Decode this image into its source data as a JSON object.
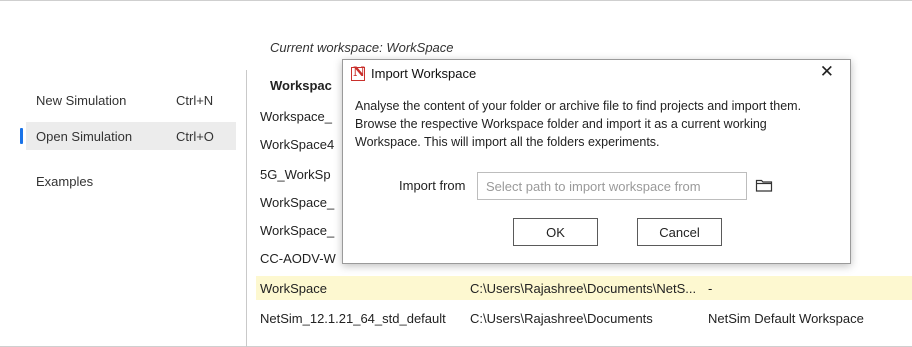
{
  "menu": {
    "items": [
      {
        "label": "New Simulation",
        "shortcut": "Ctrl+N"
      },
      {
        "label": "Open Simulation",
        "shortcut": "Ctrl+O"
      },
      {
        "label": "Examples",
        "shortcut": ""
      }
    ]
  },
  "workspace": {
    "current": "Current workspace:  WorkSpace",
    "header": "Workspac",
    "rows": [
      {
        "name": "Workspace_",
        "path": "",
        "desc": ""
      },
      {
        "name": "WorkSpace4",
        "path": "",
        "desc": ""
      },
      {
        "name": "5G_WorkSp",
        "path": "",
        "desc": ""
      },
      {
        "name": "WorkSpace_",
        "path": "",
        "desc": ""
      },
      {
        "name": "WorkSpace_",
        "path": "",
        "desc": ""
      },
      {
        "name": "CC-AODV-W",
        "path": "",
        "desc": ""
      },
      {
        "name": "WorkSpace",
        "path": "C:\\Users\\Rajashree\\Documents\\NetS...",
        "desc": "-"
      },
      {
        "name": "NetSim_12.1.21_64_std_default",
        "path": "C:\\Users\\Rajashree\\Documents",
        "desc": "NetSim Default Workspace"
      }
    ]
  },
  "dialog": {
    "title": "Import Workspace",
    "close": "✕",
    "description": "Analyse the content of your folder or archive file to find projects and import them. Browse the respective Workspace folder and import it as a current working Workspace. This will import all the folders experiments.",
    "import_label": "Import from",
    "import_placeholder": "Select path to import workspace from",
    "ok_label": "OK",
    "cancel_label": "Cancel"
  }
}
